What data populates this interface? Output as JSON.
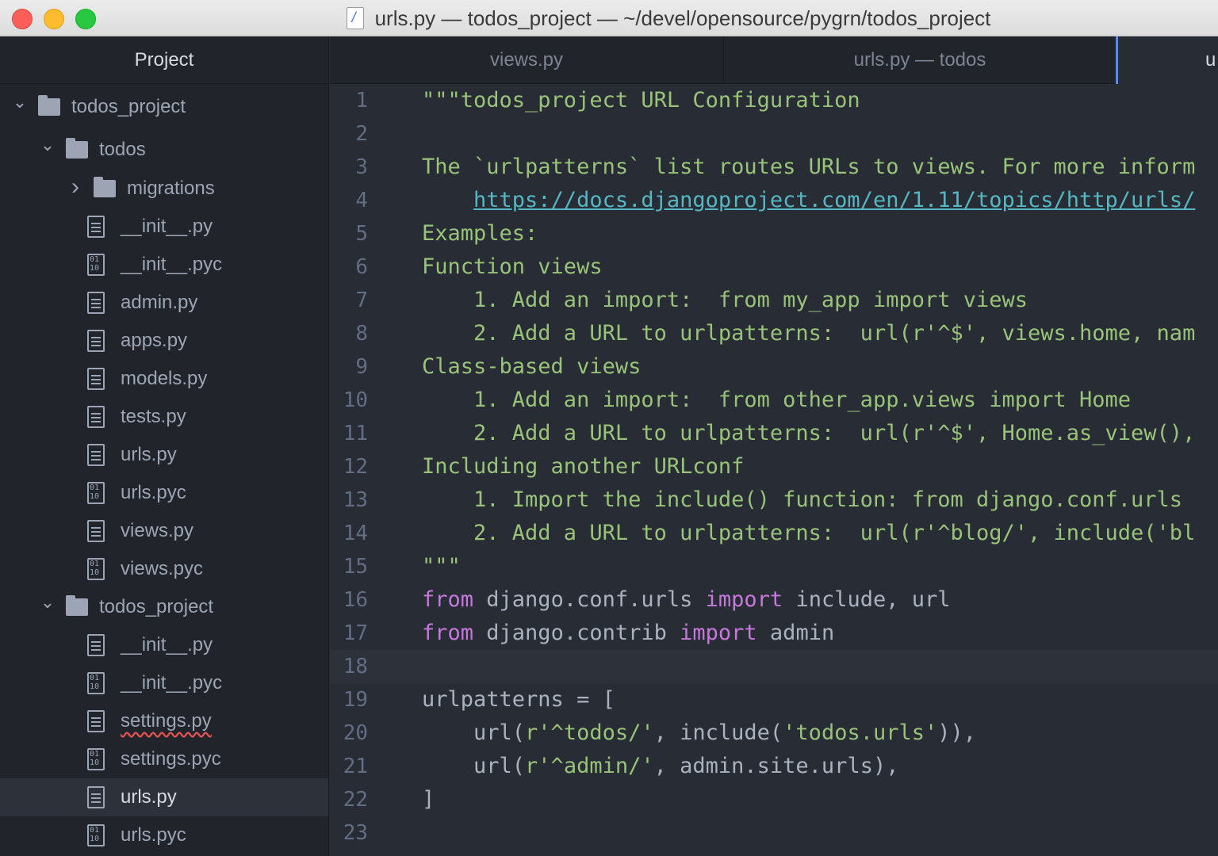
{
  "window": {
    "title": "urls.py — todos_project — ~/devel/opensource/pygrn/todos_project"
  },
  "sidebar": {
    "header": "Project",
    "tree": [
      {
        "label": "todos_project",
        "kind": "folder",
        "depth": 0,
        "expanded": true
      },
      {
        "label": "todos",
        "kind": "folder",
        "depth": 1,
        "expanded": true
      },
      {
        "label": "migrations",
        "kind": "folder",
        "depth": 2,
        "expanded": false
      },
      {
        "label": "__init__.py",
        "kind": "text",
        "depth": 2
      },
      {
        "label": "__init__.pyc",
        "kind": "binary",
        "depth": 2
      },
      {
        "label": "admin.py",
        "kind": "text",
        "depth": 2
      },
      {
        "label": "apps.py",
        "kind": "text",
        "depth": 2
      },
      {
        "label": "models.py",
        "kind": "text",
        "depth": 2
      },
      {
        "label": "tests.py",
        "kind": "text",
        "depth": 2
      },
      {
        "label": "urls.py",
        "kind": "text",
        "depth": 2
      },
      {
        "label": "urls.pyc",
        "kind": "binary",
        "depth": 2
      },
      {
        "label": "views.py",
        "kind": "text",
        "depth": 2
      },
      {
        "label": "views.pyc",
        "kind": "binary",
        "depth": 2
      },
      {
        "label": "todos_project",
        "kind": "folder",
        "depth": 1,
        "expanded": true
      },
      {
        "label": "__init__.py",
        "kind": "text",
        "depth": 2
      },
      {
        "label": "__init__.pyc",
        "kind": "binary",
        "depth": 2
      },
      {
        "label": "settings.py",
        "kind": "text",
        "depth": 2,
        "squiggle": true
      },
      {
        "label": "settings.pyc",
        "kind": "binary",
        "depth": 2
      },
      {
        "label": "urls.py",
        "kind": "text",
        "depth": 2,
        "selected": true
      },
      {
        "label": "urls.pyc",
        "kind": "binary",
        "depth": 2
      }
    ]
  },
  "tabs": [
    {
      "label": "views.py"
    },
    {
      "label": "urls.py — todos"
    },
    {
      "label": "u"
    }
  ],
  "editor": {
    "cursor_line": 18,
    "lines": [
      {
        "n": "1",
        "tokens": [
          [
            "str",
            "\"\"\"todos_project URL Configuration"
          ]
        ]
      },
      {
        "n": "2",
        "tokens": []
      },
      {
        "n": "3",
        "tokens": [
          [
            "str",
            "The `urlpatterns` list routes URLs to views. For more inform"
          ]
        ]
      },
      {
        "n": "4",
        "tokens": [
          [
            "str",
            "    "
          ],
          [
            "link",
            "https://docs.djangoproject.com/en/1.11/topics/http/urls/"
          ]
        ]
      },
      {
        "n": "5",
        "tokens": [
          [
            "str",
            "Examples:"
          ]
        ]
      },
      {
        "n": "6",
        "tokens": [
          [
            "str",
            "Function views"
          ]
        ]
      },
      {
        "n": "7",
        "tokens": [
          [
            "str",
            "    1. Add an import:  from my_app import views"
          ]
        ]
      },
      {
        "n": "8",
        "tokens": [
          [
            "str",
            "    2. Add a URL to urlpatterns:  url(r'^$', views.home, nam"
          ]
        ]
      },
      {
        "n": "9",
        "tokens": [
          [
            "str",
            "Class-based views"
          ]
        ]
      },
      {
        "n": "10",
        "tokens": [
          [
            "str",
            "    1. Add an import:  from other_app.views import Home"
          ]
        ]
      },
      {
        "n": "11",
        "tokens": [
          [
            "str",
            "    2. Add a URL to urlpatterns:  url(r'^$', Home.as_view(),"
          ]
        ]
      },
      {
        "n": "12",
        "tokens": [
          [
            "str",
            "Including another URLconf"
          ]
        ]
      },
      {
        "n": "13",
        "tokens": [
          [
            "str",
            "    1. Import the include() function: from django.conf.urls"
          ]
        ]
      },
      {
        "n": "14",
        "tokens": [
          [
            "str",
            "    2. Add a URL to urlpatterns:  url(r'^blog/', include('bl"
          ]
        ]
      },
      {
        "n": "15",
        "tokens": [
          [
            "str",
            "\"\"\""
          ]
        ]
      },
      {
        "n": "16",
        "tokens": [
          [
            "kw",
            "from"
          ],
          [
            "plain",
            " django.conf.urls "
          ],
          [
            "kw",
            "import"
          ],
          [
            "plain",
            " include, url"
          ]
        ]
      },
      {
        "n": "17",
        "tokens": [
          [
            "kw",
            "from"
          ],
          [
            "plain",
            " django.contrib "
          ],
          [
            "kw",
            "import"
          ],
          [
            "plain",
            " admin"
          ]
        ]
      },
      {
        "n": "18",
        "tokens": []
      },
      {
        "n": "19",
        "tokens": [
          [
            "plain",
            "urlpatterns = ["
          ]
        ]
      },
      {
        "n": "20",
        "tokens": [
          [
            "plain",
            "    url("
          ],
          [
            "str",
            "r'^todos/'"
          ],
          [
            "plain",
            ", include("
          ],
          [
            "str",
            "'todos.urls'"
          ],
          [
            "plain",
            ")),"
          ]
        ]
      },
      {
        "n": "21",
        "tokens": [
          [
            "plain",
            "    url("
          ],
          [
            "str",
            "r'^admin/'"
          ],
          [
            "plain",
            ", admin.site.urls),"
          ]
        ]
      },
      {
        "n": "22",
        "tokens": [
          [
            "plain",
            "]"
          ]
        ]
      },
      {
        "n": "23",
        "tokens": []
      }
    ]
  }
}
